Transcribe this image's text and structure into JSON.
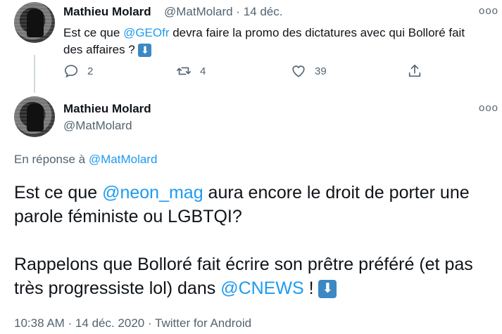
{
  "tweet1": {
    "author_name": "Mathieu Molard",
    "handle": "@MatMolard",
    "separator": "·",
    "date": "14 déc.",
    "text_before": "Est ce que ",
    "mention": "@GEOfr",
    "text_after": " devra faire la promo des dictatures avec qui Bolloré fait des affaires ? ",
    "emoji": "⬇",
    "replies": "2",
    "retweets": "4",
    "likes": "39",
    "more": "ooo"
  },
  "tweet2": {
    "author_name": "Mathieu Molard",
    "handle": "@MatMolard",
    "more": "ooo",
    "reply_prefix": "En réponse à ",
    "reply_handle": "@MatMolard",
    "line1_before": "Est ce que ",
    "line1_mention": "@neon_mag",
    "line1_after": " aura encore le droit de porter une parole féministe ou LGBTQI?",
    "line2_before": "Rappelons que Bolloré fait écrire son prêtre préféré (et pas très progressiste lol) dans ",
    "line2_mention": "@CNEWS",
    "line2_after": " ! ",
    "emoji": "⬇",
    "footer": "10:38 AM · 14 déc. 2020 · Twitter for Android"
  },
  "colors": {
    "link": "#1d9bf0",
    "secondary": "#536471",
    "text": "#0f1419"
  }
}
